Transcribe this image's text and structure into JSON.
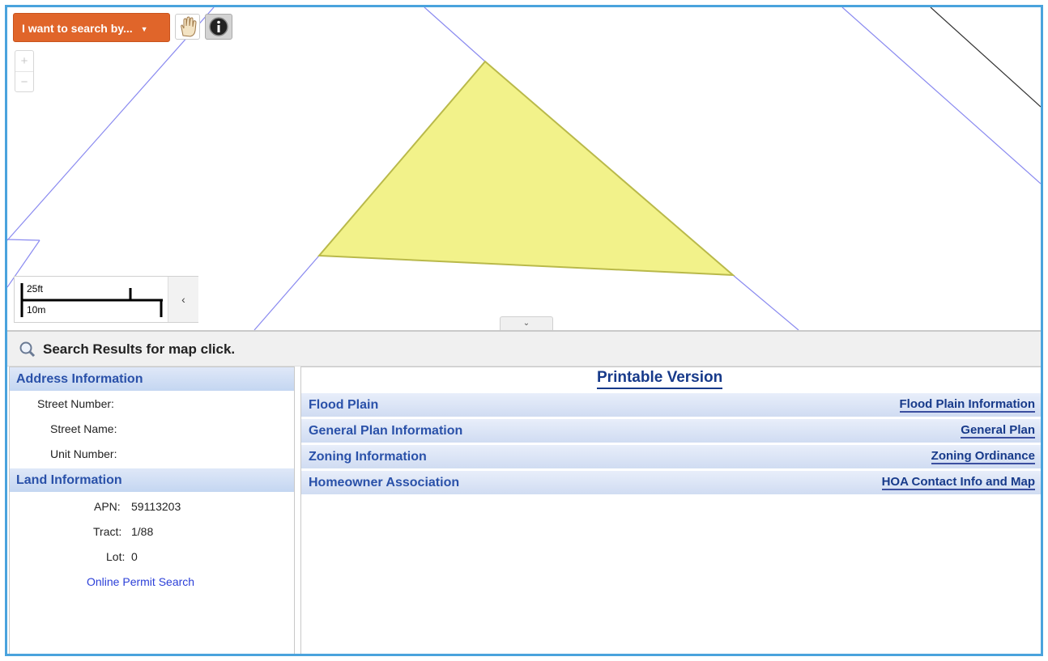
{
  "map": {
    "search_button": "I want to search by...",
    "zoom_in": "+",
    "zoom_out": "−",
    "scale_feet": "25ft",
    "scale_meters": "10m",
    "collapse_glyph": "‹",
    "expand_glyph": "⌄",
    "colors": {
      "parcel_line": "#8a8af0",
      "selected_fill": "#f2f28a",
      "selected_stroke": "#b9b94a"
    }
  },
  "results": {
    "title": "Search Results for map click."
  },
  "address": {
    "header": "Address Information",
    "street_number_label": "Street Number:",
    "street_name_label": "Street Name:",
    "unit_number_label": "Unit Number:"
  },
  "land": {
    "header": "Land Information",
    "apn_label": "APN:",
    "apn_value": "59113203",
    "tract_label": "Tract:",
    "tract_value": "1/88",
    "lot_label": "Lot:",
    "lot_value": "0",
    "permit_link": "Online Permit Search"
  },
  "details": {
    "printable": "Printable Version",
    "rows": [
      {
        "name": "Flood Plain",
        "link": "Flood Plain Information"
      },
      {
        "name": "General Plan Information",
        "link": "General Plan"
      },
      {
        "name": "Zoning Information",
        "link": "Zoning Ordinance"
      },
      {
        "name": "Homeowner Association",
        "link": "HOA Contact Info and Map"
      }
    ]
  }
}
